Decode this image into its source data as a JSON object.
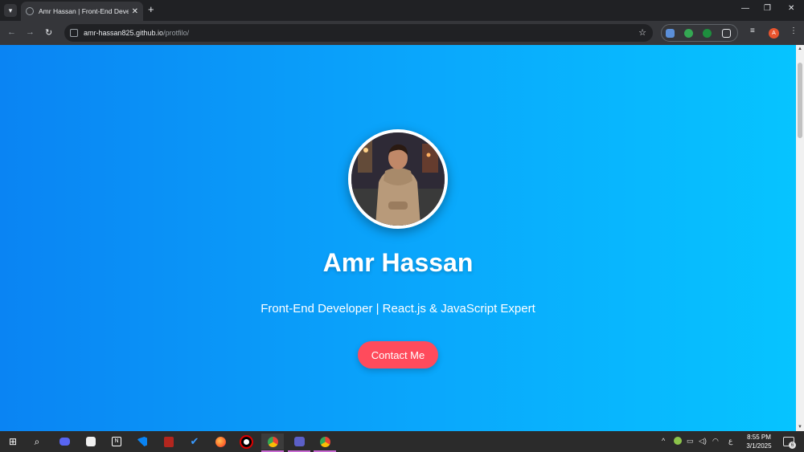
{
  "browser": {
    "tab_title": "Amr Hassan | Front-End Develo",
    "tab_close": "✕",
    "new_tab": "+",
    "minimize": "—",
    "restore": "❐",
    "close": "✕",
    "url_host": "amr-hassan825.github.io",
    "url_path": "/protfilo/",
    "profile_initial": "A"
  },
  "hero": {
    "name": "Amr Hassan",
    "subtitle": "Front-End Developer | React.js & JavaScript Expert",
    "contact_label": "Contact Me"
  },
  "colors": {
    "gradient_start": "#0a84f3",
    "gradient_end": "#06c4ff",
    "button": "#ff4b5c"
  },
  "taskbar": {
    "time": "8:55 PM",
    "date": "3/1/2025",
    "language": "ع",
    "notification_count": "6",
    "apps": [
      "start-icon",
      "search-icon",
      "discord-icon",
      "brave-icon",
      "notion-icon",
      "vscode-icon",
      "pdf-icon",
      "todo-icon",
      "firefox-icon",
      "obs-icon",
      "chrome-icon",
      "teams-icon",
      "chrome-profile-icon"
    ]
  }
}
